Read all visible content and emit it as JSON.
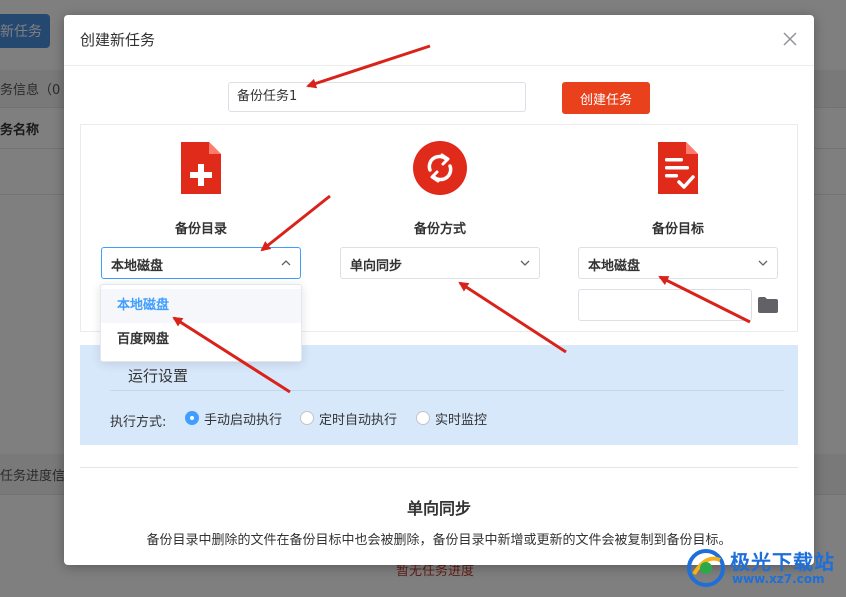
{
  "background": {
    "new_task_button": "新任务",
    "task_info": "务信息（0",
    "column_task_name": "务名称",
    "progress_info": "任务进度信息",
    "empty_progress": "暂无任务进度"
  },
  "modal": {
    "title": "创建新任务",
    "task_name_value": "备份任务1",
    "create_button": "创建任务",
    "columns": [
      {
        "label": "备份目录",
        "icon": "document-add-icon",
        "selected": "本地磁盘"
      },
      {
        "label": "备份方式",
        "icon": "sync-icon",
        "selected": "单向同步"
      },
      {
        "label": "备份目标",
        "icon": "document-check-icon",
        "selected": "本地磁盘"
      }
    ],
    "dropdown_options": [
      "本地磁盘",
      "百度网盘"
    ],
    "run_settings": {
      "title": "运行设置",
      "exec_label": "执行方式:",
      "options": [
        "手动启动执行",
        "定时自动执行",
        "实时监控"
      ],
      "selected_index": 0
    },
    "sync_mode_title": "单向同步",
    "sync_mode_description": "备份目录中删除的文件在备份目标中也会被删除，备份目录中新增或更新的文件会被复制到备份目标。"
  },
  "watermark": {
    "text": "极光下载站",
    "url": "www.xz7.com"
  },
  "colors": {
    "accent_red": "#e8411c",
    "icon_red": "#e02b1b",
    "primary_blue": "#409eff",
    "run_section_bg": "#d8e8fb",
    "arrow_red": "#d9221a"
  }
}
